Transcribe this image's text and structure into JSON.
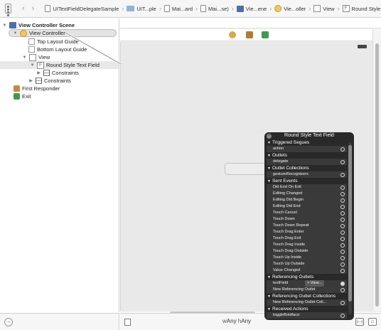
{
  "jumpbar": {
    "crumbs": [
      "UITextFieldDelegateSample",
      "UIT...ple",
      "Mai...ard",
      "Mai...se)",
      "Vie...ene",
      "Vie...oller",
      "View",
      "Round Style Text Field"
    ]
  },
  "outline": {
    "scene": "View Controller Scene",
    "view_controller": "View Controller",
    "top_layout_guide": "Top Layout Guide",
    "bottom_layout_guide": "Bottom Layout Guide",
    "view": "View",
    "text_field": "Round Style Text Field",
    "constraints_inner": "Constraints",
    "constraints_outer": "Constraints",
    "first_responder": "First Responder",
    "exit": "Exit"
  },
  "canvas": {
    "size_class": "Any",
    "size_class_h": "Any"
  },
  "hud": {
    "title": "Round Style Text Field",
    "sections": [
      {
        "label": "Triggered Segues",
        "rows": [
          {
            "label": "action",
            "connected": false
          }
        ]
      },
      {
        "label": "Outlets",
        "rows": [
          {
            "label": "delegate",
            "connected": false
          }
        ]
      },
      {
        "label": "Outlet Collections",
        "rows": [
          {
            "label": "gestureRecognizers",
            "connected": false
          }
        ]
      },
      {
        "label": "Sent Events",
        "rows": [
          {
            "label": "Did End On Exit",
            "connected": false
          },
          {
            "label": "Editing Changed",
            "connected": false
          },
          {
            "label": "Editing Did Begin",
            "connected": false
          },
          {
            "label": "Editing Did End",
            "connected": false
          },
          {
            "label": "Touch Cancel",
            "connected": false
          },
          {
            "label": "Touch Down",
            "connected": false
          },
          {
            "label": "Touch Down Repeat",
            "connected": false
          },
          {
            "label": "Touch Drag Enter",
            "connected": false
          },
          {
            "label": "Touch Drag Exit",
            "connected": false
          },
          {
            "label": "Touch Drag Inside",
            "connected": false
          },
          {
            "label": "Touch Drag Outside",
            "connected": false
          },
          {
            "label": "Touch Up Inside",
            "connected": false
          },
          {
            "label": "Touch Up Outside",
            "connected": false
          },
          {
            "label": "Value Changed",
            "connected": false
          }
        ]
      },
      {
        "label": "Referencing Outlets",
        "rows": [
          {
            "label": "textField",
            "connected": true,
            "target": "View..."
          },
          {
            "label": "New Referencing Outlet",
            "connected": false
          }
        ]
      },
      {
        "label": "Referencing Outlet Collections",
        "rows": [
          {
            "label": "New Referencing Outlet Coll...",
            "connected": false
          }
        ]
      },
      {
        "label": "Received Actions",
        "rows": [
          {
            "label": "toggleBoldface:",
            "connected": false
          }
        ]
      }
    ]
  },
  "colors": {
    "hud_bg": "#202020",
    "selection_bg": "#e3e3e3",
    "canvas_bg": "#e9e9e9"
  }
}
